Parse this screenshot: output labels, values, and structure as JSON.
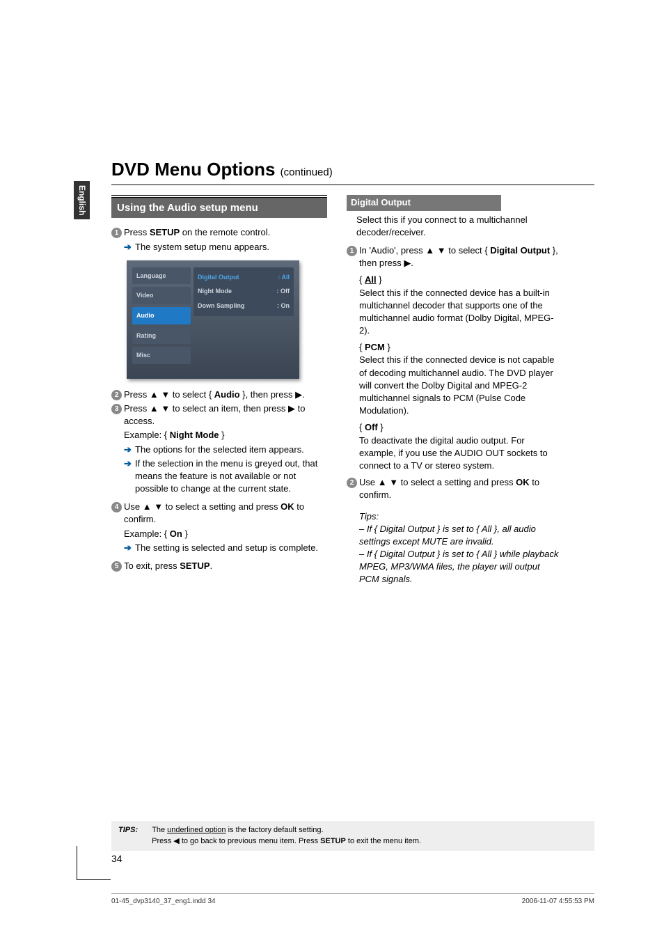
{
  "side_tab": "English",
  "title": "DVD Menu Options",
  "title_cont": "(continued)",
  "left": {
    "header": "Using the Audio setup menu",
    "step1_a": "Press ",
    "step1_b": "SETUP",
    "step1_c": " on the remote control.",
    "step1_sub": "The system setup menu appears.",
    "screenshot": {
      "tabs": [
        "Language",
        "Video",
        "Audio",
        "Rating",
        "Misc"
      ],
      "active_tab": "Audio",
      "rows": [
        {
          "label": "Digital Output",
          "value": ": All"
        },
        {
          "label": "Night  Mode",
          "value": ": Off"
        },
        {
          "label": "Down Sampling",
          "value": ": On"
        }
      ]
    },
    "step2_a": "Press ▲ ▼ to select { ",
    "step2_b": "Audio",
    "step2_c": " }, then press ▶.",
    "step3": "Press ▲ ▼ to select an item, then press ▶ to access.",
    "step3_ex_a": "Example: { ",
    "step3_ex_b": "Night Mode",
    "step3_ex_c": " }",
    "step3_sub1": "The options for the selected item appears.",
    "step3_sub2": "If the selection in the menu is greyed out, that means the feature is not available or not possible to change at the current state.",
    "step4_a": "Use ▲ ▼ to select a setting and press ",
    "step4_b": "OK",
    "step4_c": " to confirm.",
    "step4_ex_a": "Example: { ",
    "step4_ex_b": "On",
    "step4_ex_c": " }",
    "step4_sub": "The setting is selected and setup is complete.",
    "step5_a": "To exit, press ",
    "step5_b": "SETUP",
    "step5_c": "."
  },
  "right": {
    "header": "Digital Output",
    "intro": "Select this if you connect to a multichannel decoder/receiver.",
    "step1_a": "In 'Audio', press ▲ ▼ to select { ",
    "step1_b": "Digital Output",
    "step1_c": " }, then press ▶.",
    "opt_all_label": "All",
    "opt_all": "Select this if the connected device has a built-in multichannel decoder that supports one of the multichannel audio format (Dolby Digital, MPEG-2).",
    "opt_pcm_label": "PCM",
    "opt_pcm": "Select this if the connected device is not capable of decoding multichannel audio. The DVD player will convert the Dolby Digital and MPEG-2 multichannel signals to PCM (Pulse Code Modulation).",
    "opt_off_label": "Off",
    "opt_off": "To deactivate the digital audio output. For example, if you use the AUDIO OUT sockets to connect to a TV or stereo system.",
    "step2_a": "Use ▲ ▼ to select a setting and press ",
    "step2_b": "OK",
    "step2_c": " to confirm.",
    "tips_label": "Tips:",
    "tip1": "– If { Digital Output } is set to { All }, all audio settings except MUTE are invalid.",
    "tip2": "– If { Digital Output } is set to { All } while playback MPEG, MP3/WMA files, the player will output PCM signals."
  },
  "tips_bar": {
    "label": "TIPS:",
    "line1_a": "The ",
    "line1_b": "underlined option",
    "line1_c": " is the factory default setting.",
    "line2_a": "Press ◀ to go back to previous menu item. Press ",
    "line2_b": "SETUP",
    "line2_c": " to exit the menu item."
  },
  "page_num": "34",
  "footer_left": "01-45_dvp3140_37_eng1.indd   34",
  "footer_right": "2006-11-07   4:55:53 PM"
}
